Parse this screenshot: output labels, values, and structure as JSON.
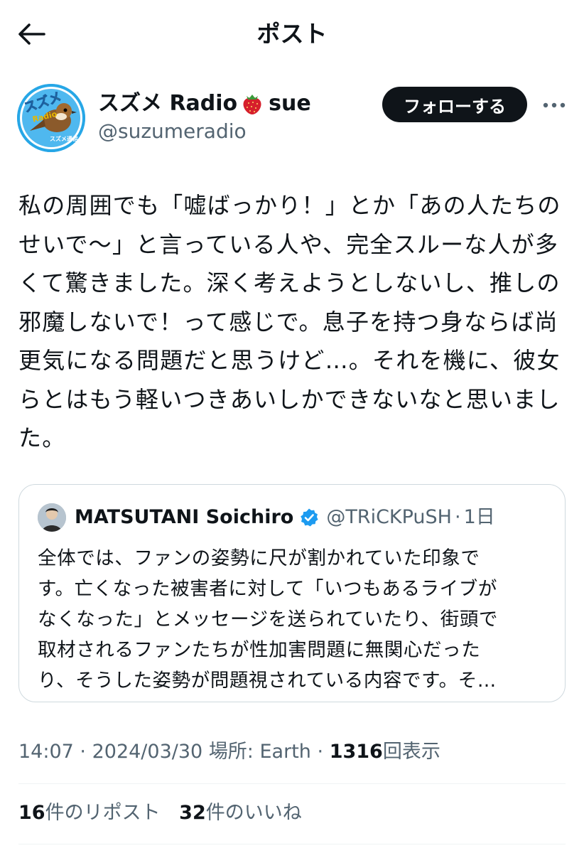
{
  "header": {
    "title": "ポスト"
  },
  "author": {
    "display_name_before": "スズメ Radio",
    "display_name_after": "sue",
    "handle": "@suzumeradio",
    "avatar_text": "スズメ",
    "avatar_sub": "Radio",
    "avatar_caption": "スズメ通信",
    "follow_label": "フォローする"
  },
  "post": {
    "lines": [
      "私の周囲でも「嘘ばっかり！」とか「あの人たちの",
      "せいで〜」と言っている人や、完全スルーな人が多",
      "くて驚きました。深く考えようとしないし、推しの",
      "邪魔しないで！って感じで。息子を持つ身ならば尚",
      "更気になる問題だと思うけど…。それを機に、彼女",
      "らとはもう軽いつきあいしかできないなと思いまし",
      "た。"
    ]
  },
  "quote": {
    "name": "MATSUTANI Soichiro",
    "handle": "@TRiCKPuSH",
    "dot": "·",
    "time": "1日",
    "lines": [
      "全体では、ファンの姿勢に尺が割かれていた印象で",
      "す。亡くなった被害者に対して「いつもあるライブが",
      "なくなった」とメッセージを送られていたり、街頭で",
      "取材されるファンたちが性加害問題に無関心だった",
      "り、そうした姿勢が問題視されている内容です。そ…"
    ]
  },
  "meta": {
    "time": "14:07",
    "sep1": "·",
    "date": "2024/03/30",
    "location": "場所: Earth",
    "sep2": "·",
    "views_count": "1316",
    "views_label": "回表示"
  },
  "stats": {
    "reposts_count": "16",
    "reposts_label": "件のリポスト",
    "likes_count": "32",
    "likes_label": "件のいいね"
  },
  "colors": {
    "text": "#0f1419",
    "secondary": "#536471",
    "border": "#cfd9de",
    "verified": "#1d9bf0",
    "follow_bg": "#0f1419"
  },
  "icons": {
    "back": "back-arrow-icon",
    "more": "more-dots-icon",
    "strawberry": "strawberry-emoji",
    "verified": "verified-badge-icon"
  }
}
